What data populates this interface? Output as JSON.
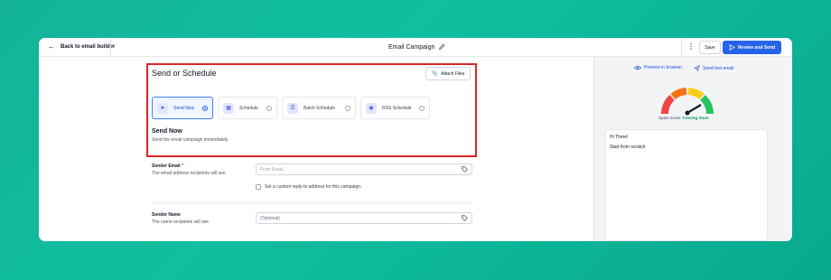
{
  "header": {
    "back_label": "Back to email builder",
    "title": "Email Campaign",
    "save_label": "Save",
    "review_label": "Review and Send"
  },
  "send_section": {
    "title": "Send or Schedule",
    "attach_label": "Attach Files",
    "options": [
      {
        "label": "Send Now",
        "selected": true
      },
      {
        "label": "Schedule",
        "selected": false
      },
      {
        "label": "Batch Schedule",
        "selected": false
      },
      {
        "label": "RSS Schedule",
        "selected": false
      }
    ],
    "current_title": "Send Now",
    "current_desc": "Send the email campaign immediately"
  },
  "sender": {
    "email_label": "Sender Email",
    "email_required_mark": "*",
    "email_help": "The email address recipients will see",
    "email_placeholder": "From Email",
    "reply_to_label": "Set a custom reply-to address for this campaign.",
    "name_label": "Sender Name",
    "name_help": "The name recipients will see",
    "name_placeholder": "(Optional)"
  },
  "preview": {
    "preview_browser_label": "Preview in browser",
    "send_test_label": "Send test email",
    "spam_label": "Spam score:",
    "spam_value": "Coming Soon",
    "email_lines": [
      "Hi There!",
      "Start from scratch"
    ]
  },
  "colors": {
    "accent": "#2563eb",
    "highlight_border": "#dc2626",
    "background": "#12b59b"
  },
  "icons": {
    "back": "arrow-left-icon",
    "edit": "pencil-icon",
    "more": "kebab-icon",
    "send": "send-icon",
    "attach": "paperclip-icon",
    "tag": "tag-icon",
    "preview": "eye-icon"
  }
}
